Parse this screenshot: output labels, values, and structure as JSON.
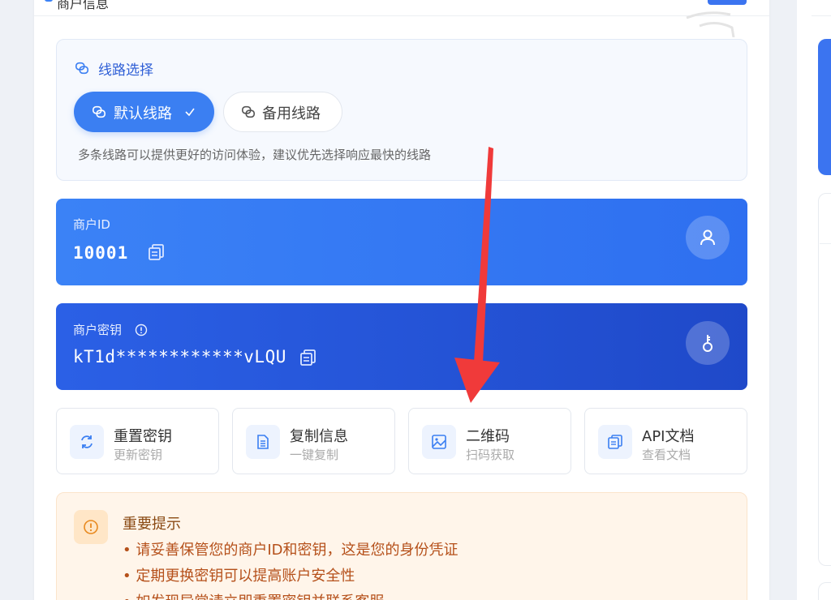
{
  "header": {
    "title": "商户信息"
  },
  "route": {
    "title": "线路选择",
    "default_label": "默认线路",
    "backup_label": "备用线路",
    "hint": "多条线路可以提供更好的访问体验，建议优先选择响应最快的线路"
  },
  "merchant_id": {
    "label": "商户ID",
    "value": "10001"
  },
  "merchant_key": {
    "label": "商户密钥",
    "value": "kT1d************vLQU"
  },
  "actions": [
    {
      "title": "重置密钥",
      "subtitle": "更新密钥",
      "icon": "refresh-icon"
    },
    {
      "title": "复制信息",
      "subtitle": "一键复制",
      "icon": "document-icon"
    },
    {
      "title": "二维码",
      "subtitle": "扫码获取",
      "icon": "image-icon"
    },
    {
      "title": "API文档",
      "subtitle": "查看文档",
      "icon": "copy-doc-icon"
    }
  ],
  "notice": {
    "title": "重要提示",
    "items": [
      "• 请妥善保管您的商户ID和密钥，这是您的身份凭证",
      "• 定期更换密钥可以提高账户安全性",
      "• 如发现异常请立即重置密钥并联系客服"
    ]
  },
  "colors": {
    "accent": "#3b7ff2",
    "key_card": "#2453d8",
    "notice_bg": "#fff5ea",
    "notice_text": "#b5501a",
    "annotation_arrow": "#f03a3a"
  }
}
